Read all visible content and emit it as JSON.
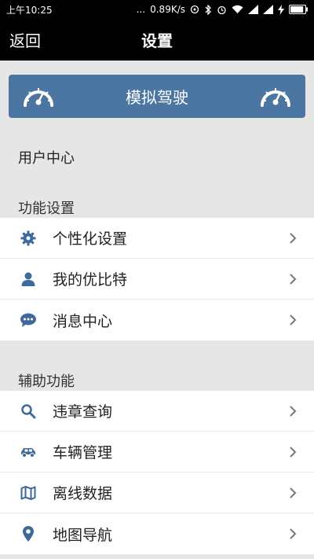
{
  "status_bar": {
    "time": "上午10:25",
    "dots": "...",
    "speed": "0.89K/s",
    "battery_level": 0.9
  },
  "header": {
    "back_label": "返回",
    "title": "设置"
  },
  "banner": {
    "label": "模拟驾驶",
    "icon": "speedometer-icon",
    "color": "#4a76a1"
  },
  "user_center": {
    "label": "用户中心"
  },
  "function_settings": {
    "title": "功能设置",
    "items": [
      {
        "label": "个性化设置",
        "icon": "gear-icon"
      },
      {
        "label": "我的优比特",
        "icon": "person-icon"
      },
      {
        "label": "消息中心",
        "icon": "message-icon"
      }
    ]
  },
  "aux_functions": {
    "title": "辅助功能",
    "items": [
      {
        "label": "违章查询",
        "icon": "search-icon"
      },
      {
        "label": "车辆管理",
        "icon": "car-icon"
      },
      {
        "label": "离线数据",
        "icon": "map-icon"
      },
      {
        "label": "地图导航",
        "icon": "location-pin-icon"
      }
    ]
  },
  "colors": {
    "accent": "#4a76a1",
    "icon": "#3d6a99",
    "background": "#e6e6e6"
  }
}
